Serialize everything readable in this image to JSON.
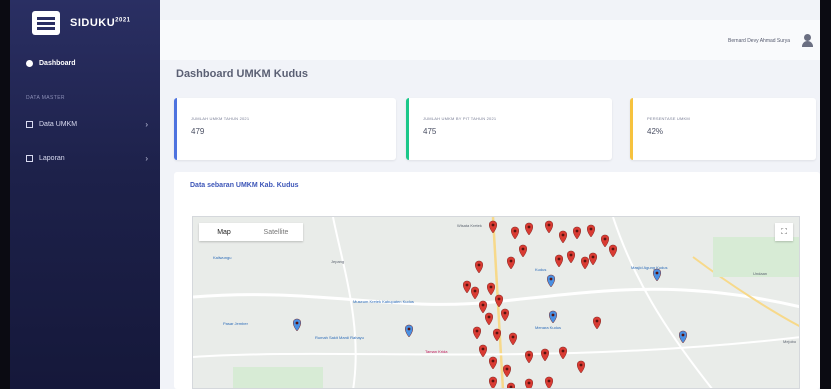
{
  "app": {
    "name": "SIDUKU",
    "year": "2021"
  },
  "sidebar": {
    "active": "Dashboard",
    "heading": "DATA MASTER",
    "items": [
      {
        "label": "Data UMKM",
        "chevron": "›"
      },
      {
        "label": "Laporan",
        "chevron": "›"
      }
    ]
  },
  "topbar": {
    "user": "Bernard Devy Ahmad Surya"
  },
  "page": {
    "title": "Dashboard UMKM Kudus"
  },
  "cards": [
    {
      "label": "JUMLAH UMKM TAHUN 2021",
      "value": "479"
    },
    {
      "label": "JUMLAH UMKM BY PIT TAHUN 2021",
      "value": "475"
    },
    {
      "label": "PERSENTASE UMKM",
      "value": "42%"
    }
  ],
  "map": {
    "title": "Data sebaran UMKM Kab. Kudus",
    "tabs": {
      "map": "Map",
      "satellite": "Satellite"
    },
    "fullscreen": "⛶",
    "labels": [
      {
        "text": "Kaliwungu",
        "cls": "blue"
      },
      {
        "text": "Jepang",
        "cls": ""
      },
      {
        "text": "Wisata Kretek",
        "cls": ""
      },
      {
        "text": "Museum Kretek Kabupaten Kudus",
        "cls": "blue"
      },
      {
        "text": "Pasar Jember",
        "cls": "blue"
      },
      {
        "text": "Rumah Sakit Mardi Rahayu",
        "cls": "blue"
      },
      {
        "text": "Kudus",
        "cls": "blue"
      },
      {
        "text": "Menara Kudus",
        "cls": "blue"
      },
      {
        "text": "Masjid Agung Kudus",
        "cls": "blue"
      },
      {
        "text": "Taman Krida",
        "cls": "pink"
      },
      {
        "text": "Undaan",
        "cls": ""
      },
      {
        "text": "Mejobo",
        "cls": ""
      }
    ]
  },
  "colors": {
    "sidebar": "#1d214a",
    "pin": "#d93b33",
    "accent": "#4e73df"
  }
}
